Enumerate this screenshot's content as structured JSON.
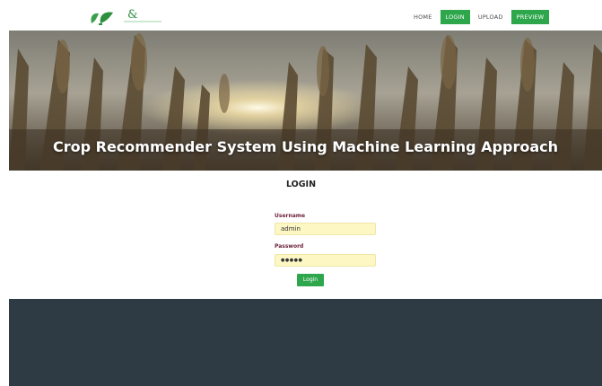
{
  "nav": {
    "items": [
      {
        "label": "HOME",
        "active": false
      },
      {
        "label": "LOGIN",
        "active": true
      },
      {
        "label": "UPLOAD",
        "active": false
      },
      {
        "label": "PREVIEW",
        "active": true
      }
    ]
  },
  "logo": {
    "mark_text": "&",
    "icon": "leaf-logo-icon"
  },
  "hero": {
    "title": "Crop Recommender System Using Machine Learning Approach"
  },
  "login": {
    "title": "LOGIN",
    "username_label": "Username",
    "username_value": "admin",
    "password_label": "Password",
    "password_value": "●●●●●",
    "button_label": "Login"
  },
  "colors": {
    "accent_green": "#2ea74c",
    "input_bg": "#fdf7c4",
    "label_color": "#6b1f3a",
    "footer_bg": "#2e3b44"
  }
}
